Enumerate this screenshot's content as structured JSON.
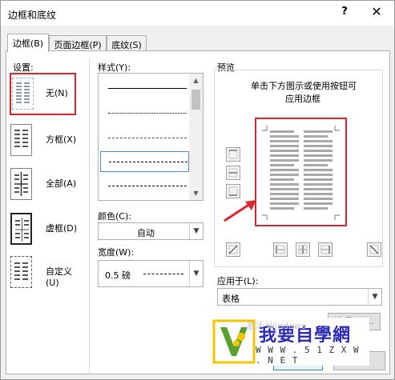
{
  "window": {
    "title": "边框和底纹",
    "help_label": "?",
    "close_label": "✕"
  },
  "tabs": [
    {
      "label": "边框(B)",
      "active": true
    },
    {
      "label": "页面边框(P)",
      "active": false
    },
    {
      "label": "底纹(S)",
      "active": false
    }
  ],
  "settings": {
    "label": "设置:",
    "items": [
      {
        "label": "无(N)",
        "icon": "border-none-icon",
        "selected": true
      },
      {
        "label": "方框(X)",
        "icon": "border-box-icon",
        "selected": false
      },
      {
        "label": "全部(A)",
        "icon": "border-all-icon",
        "selected": false
      },
      {
        "label": "虚框(D)",
        "icon": "border-grid-icon",
        "selected": false
      },
      {
        "label": "自定义(U)",
        "icon": "border-custom-icon",
        "selected": false
      }
    ]
  },
  "style": {
    "label": "样式(Y):",
    "options": [
      "solid",
      "dotted",
      "dash-dot",
      "dashed-selected",
      "dash-dot-dot",
      "long-dash"
    ],
    "selected_index": 3
  },
  "color": {
    "label": "颜色(C):",
    "value": "自动"
  },
  "width": {
    "label": "宽度(W):",
    "value": "0.5 磅"
  },
  "preview": {
    "label": "预览",
    "hint_line1": "单击下方图示或使用按钮可",
    "hint_line2": "应用边框"
  },
  "apply_to": {
    "label": "应用于(L):",
    "value": "表格"
  },
  "options_button": "选项(O)...",
  "watermark": {
    "title": "我要自學網",
    "url": "W W W . 5 1 Z X W . N E T",
    "faint": "激活 Windows"
  },
  "colors": {
    "highlight": "#d9262c",
    "watermark_text": "#2b2bb8",
    "logo_green": "#5aa02c",
    "logo_yellow": "#f2c500"
  }
}
